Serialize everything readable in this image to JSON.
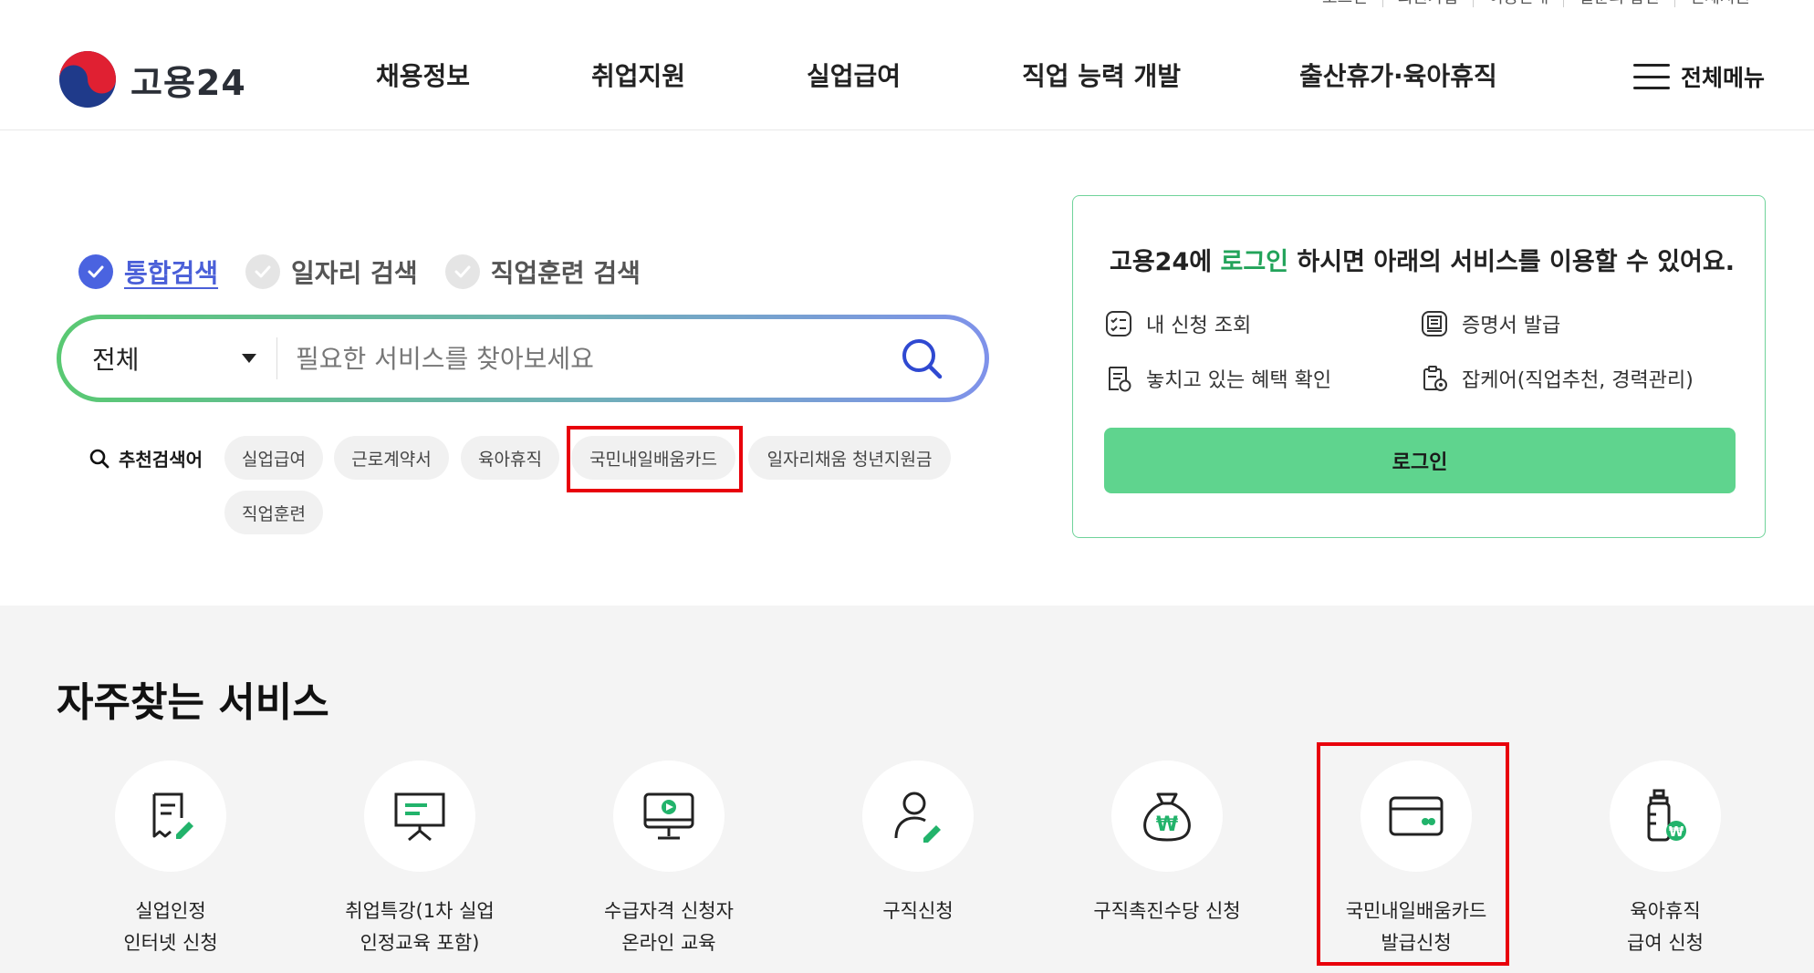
{
  "utility_links": [
    "로그인",
    "회원가입",
    "이용안내",
    "일문의 답변",
    "전체지원"
  ],
  "header": {
    "logo_text": "고용24",
    "nav": [
      "채용정보",
      "취업지원",
      "실업급여",
      "직업 능력 개발",
      "출산휴가·육아휴직"
    ],
    "all_menu_label": "전체메뉴"
  },
  "search": {
    "tabs": [
      {
        "label": "통합검색",
        "active": true
      },
      {
        "label": "일자리 검색",
        "active": false
      },
      {
        "label": "직업훈련 검색",
        "active": false
      }
    ],
    "scope_selected": "전체",
    "placeholder": "필요한 서비스를 찾아보세요",
    "recommended_label": "추천검색어",
    "keywords": [
      "실업급여",
      "근로계약서",
      "육아휴직",
      "국민내일배움카드",
      "일자리채움 청년지원금",
      "직업훈련"
    ]
  },
  "login_card": {
    "title_before": "고용24에 ",
    "title_highlight": "로그인",
    "title_after": " 하시면 아래의 서비스를 이용할 수 있어요.",
    "items": [
      {
        "label": "내 신청 조회",
        "icon": "checklist-icon"
      },
      {
        "label": "증명서 발급",
        "icon": "certificate-icon"
      },
      {
        "label": "놓치고 있는 혜택 확인",
        "icon": "benefit-document-icon"
      },
      {
        "label": "잡케어(직업추천, 경력관리)",
        "icon": "job-care-icon"
      }
    ],
    "button_label": "로그인"
  },
  "frequent_services": {
    "title": "자주찾는 서비스",
    "items": [
      {
        "label": "실업인정\n인터넷 신청",
        "icon": "document-pen-icon"
      },
      {
        "label": "취업특강(1차 실업\n인정교육 포함)",
        "icon": "presentation-board-icon"
      },
      {
        "label": "수급자격 신청자\n온라인 교육",
        "icon": "monitor-play-icon"
      },
      {
        "label": "구직신청",
        "icon": "person-pen-icon"
      },
      {
        "label": "구직촉진수당 신청",
        "icon": "money-bag-icon"
      },
      {
        "label": "국민내일배움카드\n발급신청",
        "icon": "card-icon"
      },
      {
        "label": "육아휴직\n급여 신청",
        "icon": "baby-bottle-icon"
      }
    ]
  },
  "colors": {
    "accent_green": "#5fd48e",
    "accent_blue": "#4a63e0",
    "highlight_red": "#e8000b"
  }
}
